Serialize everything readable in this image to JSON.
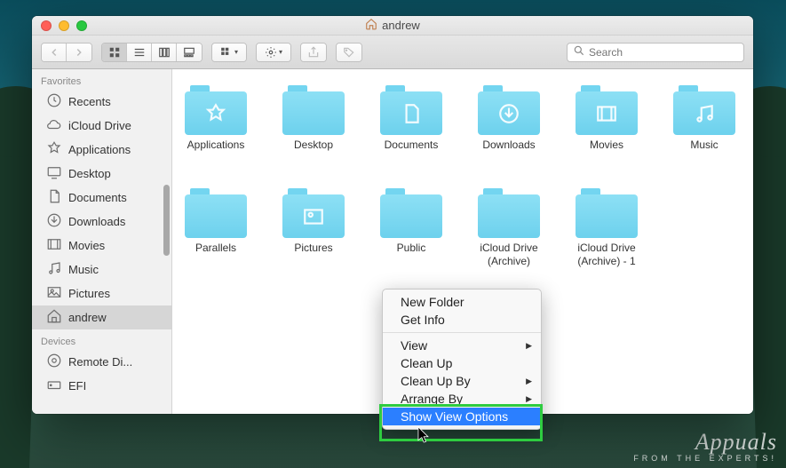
{
  "window": {
    "title": "andrew",
    "close": "Close",
    "minimize": "Minimize",
    "maximize": "Zoom"
  },
  "toolbar": {
    "search_placeholder": "Search"
  },
  "sidebar": {
    "favorites_label": "Favorites",
    "devices_label": "Devices",
    "favorites": [
      {
        "label": "Recents",
        "icon": "clock"
      },
      {
        "label": "iCloud Drive",
        "icon": "cloud"
      },
      {
        "label": "Applications",
        "icon": "app"
      },
      {
        "label": "Desktop",
        "icon": "desktop"
      },
      {
        "label": "Documents",
        "icon": "doc"
      },
      {
        "label": "Downloads",
        "icon": "download"
      },
      {
        "label": "Movies",
        "icon": "movie"
      },
      {
        "label": "Music",
        "icon": "music"
      },
      {
        "label": "Pictures",
        "icon": "picture"
      },
      {
        "label": "andrew",
        "icon": "home",
        "selected": true
      }
    ],
    "devices": [
      {
        "label": "Remote Di...",
        "icon": "disc"
      },
      {
        "label": "EFI",
        "icon": "drive"
      }
    ]
  },
  "folders": [
    {
      "label": "Applications",
      "glyph": "app"
    },
    {
      "label": "Desktop",
      "glyph": ""
    },
    {
      "label": "Documents",
      "glyph": "doc"
    },
    {
      "label": "Downloads",
      "glyph": "download"
    },
    {
      "label": "Movies",
      "glyph": "movie"
    },
    {
      "label": "Music",
      "glyph": "music"
    },
    {
      "label": "Parallels",
      "glyph": ""
    },
    {
      "label": "Pictures",
      "glyph": "picture"
    },
    {
      "label": "Public",
      "glyph": ""
    },
    {
      "label": "iCloud Drive (Archive)",
      "glyph": ""
    },
    {
      "label": "iCloud Drive (Archive) - 1",
      "glyph": ""
    }
  ],
  "context_menu": [
    {
      "label": "New Folder",
      "type": "item"
    },
    {
      "label": "Get Info",
      "type": "item"
    },
    {
      "type": "sep"
    },
    {
      "label": "View",
      "type": "submenu"
    },
    {
      "label": "Clean Up",
      "type": "item"
    },
    {
      "label": "Clean Up By",
      "type": "submenu"
    },
    {
      "label": "Arrange By",
      "type": "submenu"
    },
    {
      "label": "Show View Options",
      "type": "item",
      "selected": true
    }
  ],
  "watermark": {
    "brand": "Appuals",
    "tag": "FROM THE EXPERTS!"
  }
}
